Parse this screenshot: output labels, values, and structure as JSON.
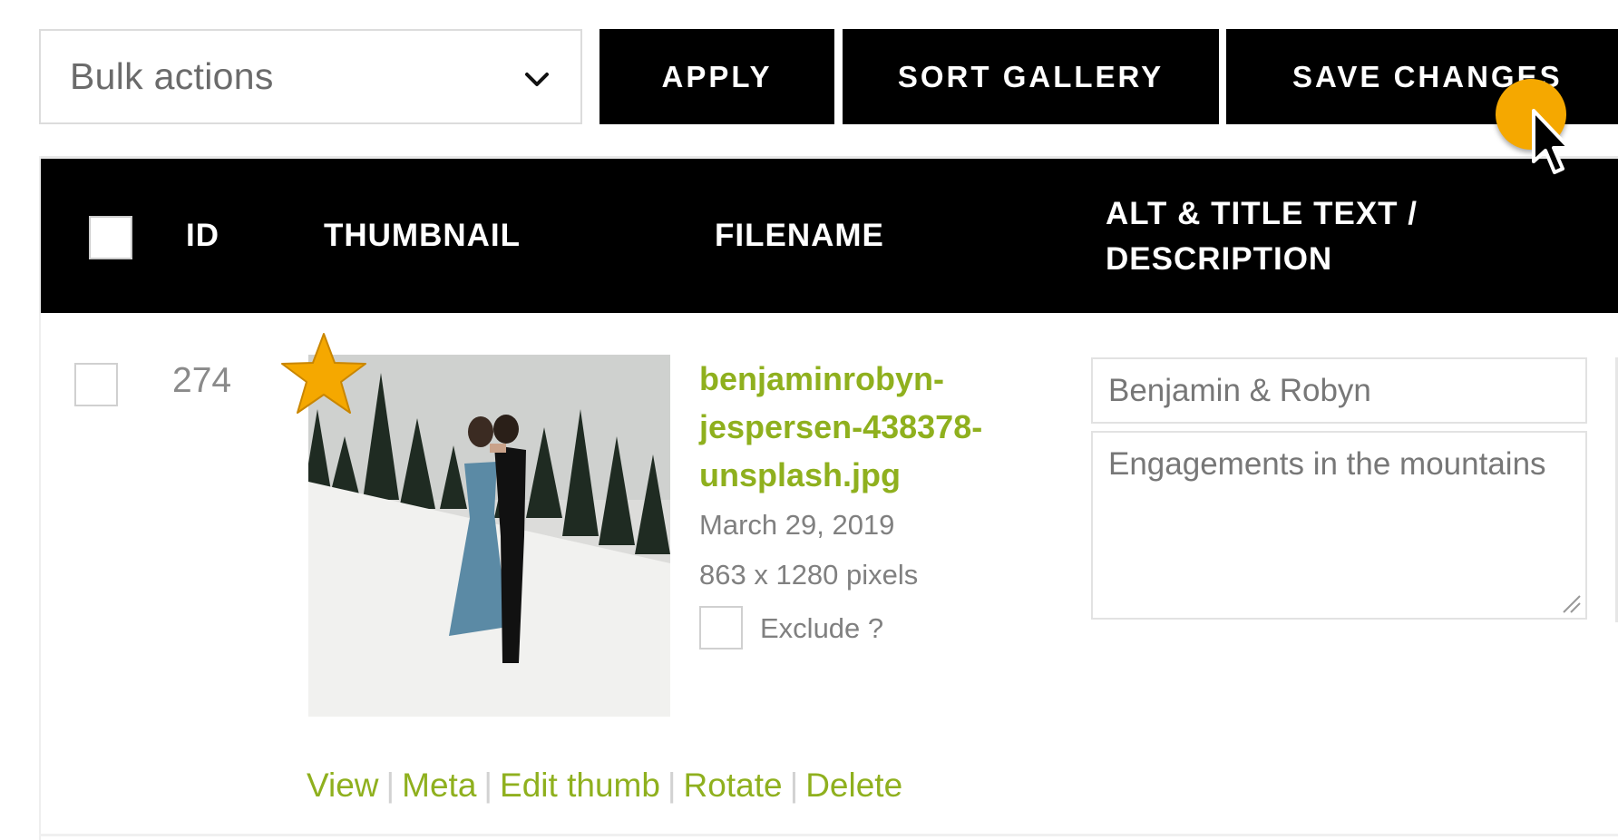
{
  "toolbar": {
    "bulk_actions_label": "Bulk actions",
    "apply_label": "APPLY",
    "sort_label": "SORT GALLERY",
    "save_label": "SAVE CHANGES"
  },
  "table": {
    "headers": {
      "id": "ID",
      "thumbnail": "THUMBNAIL",
      "filename": "FILENAME",
      "alt_line1": "ALT & TITLE TEXT /",
      "alt_line2": "DESCRIPTION"
    },
    "row": {
      "id": "274",
      "filename_line1": "benjaminrobyn-",
      "filename_line2": "jespersen-438378-",
      "filename_line3": "unsplash.jpg",
      "date": "March 29, 2019",
      "dimensions": "863 x 1280 pixels",
      "exclude_label": "Exclude ?",
      "alt_text": "Benjamin & Robyn",
      "description": "Engagements in the mountains",
      "actions": {
        "view": "View",
        "meta": "Meta",
        "edit_thumb": "Edit thumb",
        "rotate": "Rotate",
        "delete": "Delete"
      }
    }
  },
  "colors": {
    "accent_green": "#8fb01e",
    "header_black": "#000000",
    "star_orange": "#f5a800"
  }
}
